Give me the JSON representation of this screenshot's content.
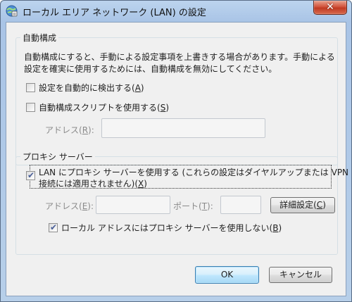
{
  "window": {
    "title": "ローカル エリア ネットワーク (LAN) の設定",
    "close_label": "✕"
  },
  "auto_config": {
    "group_title": "自動構成",
    "description_line1": "自動構成にすると、手動による設定事項を上書きする場合があります。手動による",
    "description_line2": "設定を確実に使用するためには、自動構成を無効にしてください。",
    "auto_detect": {
      "label": "設定を自動的に検出する(",
      "accel": "A",
      "suffix": ")",
      "checked": false
    },
    "use_script": {
      "label": "自動構成スクリプトを使用する(",
      "accel": "S",
      "suffix": ")",
      "checked": false
    },
    "address_label": {
      "text": "アドレス(",
      "accel": "R",
      "suffix": "):"
    },
    "address_value": ""
  },
  "proxy": {
    "group_title": "プロキシ サーバー",
    "use_proxy": {
      "line1": "LAN にプロキシ サーバーを使用する (これらの設定はダイヤルアップまたは VPN",
      "line2": "接続には適用されません)(",
      "accel": "X",
      "suffix": ")",
      "checked": true
    },
    "address_label": {
      "text": "アドレス(",
      "accel": "E",
      "suffix": "):"
    },
    "address_value": "",
    "port_label": {
      "text": "ポート(",
      "accel": "T",
      "suffix": "):"
    },
    "port_value": "",
    "advanced_button": {
      "text": "詳細設定(",
      "accel": "C",
      "suffix": ")"
    },
    "bypass_local": {
      "label": "ローカル アドレスにはプロキシ サーバーを使用しない(",
      "accel": "B",
      "suffix": ")",
      "checked": true
    }
  },
  "buttons": {
    "ok": "OK",
    "cancel": "キャンセル"
  },
  "colors": {
    "title_bar": "#a9c4e6",
    "client_bg": "#f0f0f0",
    "close_button": "#c03a22",
    "default_button_border": "#3c7fb1",
    "checkmark": "#4a5f97"
  }
}
